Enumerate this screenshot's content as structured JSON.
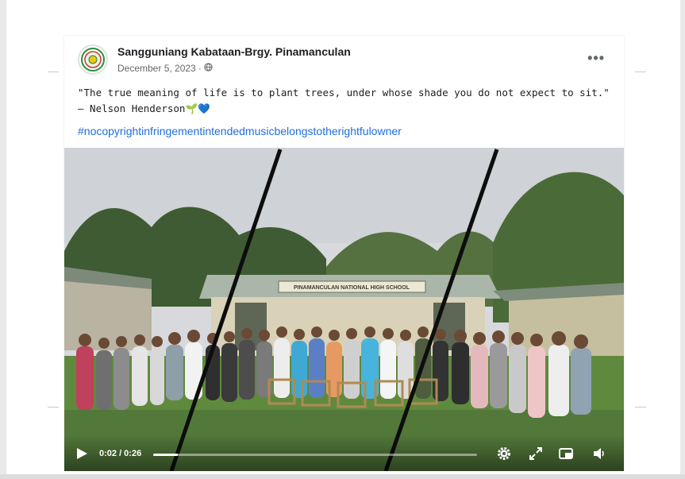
{
  "post": {
    "page_name": "Sangguniang Kabataan-Brgy. Pinamanculan",
    "date": "December 5, 2023",
    "separator": "·",
    "privacy_icon": "globe-icon",
    "more_icon": "more-options-icon",
    "more_label": "•••",
    "quote": "\"The true meaning of life is to plant trees, under whose shade you do not expect to sit.\" — Nelson Henderson🌱💙",
    "hashtag": "#nocopyrightinfringementintendedmusicbelongstotherightfulowner"
  },
  "video": {
    "school_sign": "PINAMANCULAN NATIONAL HIGH SCHOOL",
    "time": "0:02 / 0:26",
    "progress": 0.077,
    "icons": [
      "play-icon",
      "settings-gear-icon",
      "fullscreen-icon",
      "picture-in-picture-icon",
      "volume-icon"
    ]
  }
}
